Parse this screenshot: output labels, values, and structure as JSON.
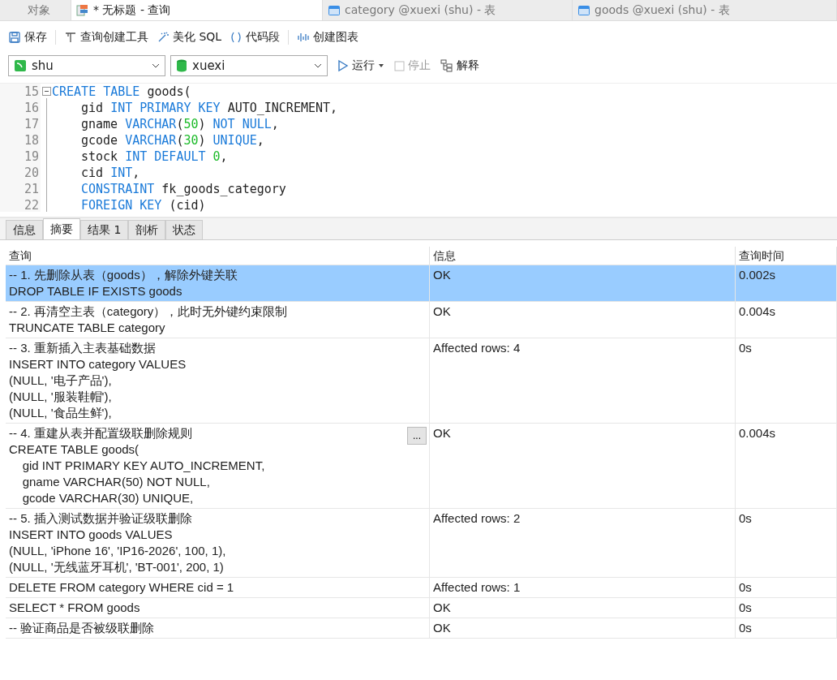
{
  "tabs": [
    {
      "label": "对象",
      "kind": "plain",
      "selected": false
    },
    {
      "label": "* 无标题 - 查询",
      "kind": "query",
      "selected": true
    },
    {
      "label": "category @xuexi (shu) - 表",
      "kind": "table",
      "selected": false
    },
    {
      "label": "goods @xuexi (shu) - 表",
      "kind": "table",
      "selected": false
    }
  ],
  "toolbar": [
    {
      "label": "保存",
      "kind": "save"
    },
    {
      "label": "查询创建工具",
      "kind": "builder"
    },
    {
      "label": "美化 SQL",
      "kind": "beautify"
    },
    {
      "label": "代码段",
      "kind": "snippet"
    },
    {
      "label": "创建图表",
      "kind": "chart"
    }
  ],
  "connection": {
    "value": "shu"
  },
  "database": {
    "value": "xuexi"
  },
  "actions": [
    {
      "label": "运行",
      "kind": "run",
      "disabled": false
    },
    {
      "label": "停止",
      "kind": "stop",
      "disabled": true
    },
    {
      "label": "解释",
      "kind": "explain",
      "disabled": false
    }
  ],
  "editor": {
    "lines": [
      {
        "number": "15",
        "fold": true,
        "indent": false,
        "tokens": [
          {
            "t": "CREATE TABLE ",
            "kind": "keyword"
          },
          {
            "t": "goods(",
            "kind": "plain"
          }
        ]
      },
      {
        "number": "16",
        "fold": false,
        "indent": true,
        "tokens": [
          {
            "t": "gid ",
            "kind": "plain"
          },
          {
            "t": "INT PRIMARY KEY ",
            "kind": "keyword"
          },
          {
            "t": "AUTO_INCREMENT,",
            "kind": "plain"
          }
        ]
      },
      {
        "number": "17",
        "fold": false,
        "indent": true,
        "tokens": [
          {
            "t": "gname ",
            "kind": "plain"
          },
          {
            "t": "VARCHAR",
            "kind": "keyword"
          },
          {
            "t": "(",
            "kind": "plain"
          },
          {
            "t": "50",
            "kind": "number"
          },
          {
            "t": ") ",
            "kind": "plain"
          },
          {
            "t": "NOT NULL",
            "kind": "keyword"
          },
          {
            "t": ",",
            "kind": "plain"
          }
        ]
      },
      {
        "number": "18",
        "fold": false,
        "indent": true,
        "tokens": [
          {
            "t": "gcode ",
            "kind": "plain"
          },
          {
            "t": "VARCHAR",
            "kind": "keyword"
          },
          {
            "t": "(",
            "kind": "plain"
          },
          {
            "t": "30",
            "kind": "number"
          },
          {
            "t": ") ",
            "kind": "plain"
          },
          {
            "t": "UNIQUE",
            "kind": "keyword"
          },
          {
            "t": ",",
            "kind": "plain"
          }
        ]
      },
      {
        "number": "19",
        "fold": false,
        "indent": true,
        "tokens": [
          {
            "t": "stock ",
            "kind": "plain"
          },
          {
            "t": "INT DEFAULT ",
            "kind": "keyword"
          },
          {
            "t": "0",
            "kind": "number"
          },
          {
            "t": ",",
            "kind": "plain"
          }
        ]
      },
      {
        "number": "20",
        "fold": false,
        "indent": true,
        "tokens": [
          {
            "t": "cid ",
            "kind": "plain"
          },
          {
            "t": "INT",
            "kind": "keyword"
          },
          {
            "t": ",",
            "kind": "plain"
          }
        ]
      },
      {
        "number": "21",
        "fold": false,
        "indent": true,
        "tokens": [
          {
            "t": "CONSTRAINT ",
            "kind": "keyword"
          },
          {
            "t": "fk_goods_category",
            "kind": "plain"
          }
        ]
      },
      {
        "number": "22",
        "fold": false,
        "indent": true,
        "tokens": [
          {
            "t": "FOREIGN KEY ",
            "kind": "keyword"
          },
          {
            "t": "(cid)",
            "kind": "plain"
          }
        ]
      }
    ]
  },
  "result_tabs": [
    {
      "label": "信息",
      "selected": false
    },
    {
      "label": "摘要",
      "selected": true
    },
    {
      "label": "结果 1",
      "selected": false
    },
    {
      "label": "剖析",
      "selected": false
    },
    {
      "label": "状态",
      "selected": false
    }
  ],
  "summary": {
    "columns": [
      "查询",
      "信息",
      "查询时间"
    ],
    "rows": [
      {
        "query": [
          "-- 1. 先删除从表（goods），解除外键关联",
          "DROP TABLE IF EXISTS goods"
        ],
        "info": "OK",
        "time": "0.002s",
        "selected": true
      },
      {
        "query": [
          "-- 2. 再清空主表（category），此时无外键约束限制",
          "TRUNCATE TABLE category"
        ],
        "info": "OK",
        "time": "0.004s",
        "selected": false
      },
      {
        "query": [
          "-- 3. 重新插入主表基础数据",
          "INSERT INTO category VALUES",
          "(NULL, '电子产品'),",
          "(NULL, '服装鞋帽'),",
          "(NULL, '食品生鲜'),"
        ],
        "info": "Affected rows: 4",
        "time": "0s",
        "selected": false
      },
      {
        "query": [
          "-- 4. 重建从表并配置级联删除规则",
          "CREATE TABLE goods(",
          "    gid INT PRIMARY KEY AUTO_INCREMENT,",
          "    gname VARCHAR(50) NOT NULL,",
          "    gcode VARCHAR(30) UNIQUE,"
        ],
        "more_button": "...",
        "info": "OK",
        "time": "0.004s",
        "selected": false
      },
      {
        "query": [
          "-- 5. 插入测试数据并验证级联删除",
          "INSERT INTO goods VALUES",
          "(NULL, 'iPhone 16', 'IP16-2026', 100, 1),",
          "(NULL, '无线蓝牙耳机', 'BT-001', 200, 1)"
        ],
        "info": "Affected rows: 2",
        "time": "0s",
        "selected": false
      },
      {
        "query": [
          "DELETE FROM category WHERE cid = 1"
        ],
        "info": "Affected rows: 1",
        "time": "0s",
        "selected": false
      },
      {
        "query": [
          "SELECT * FROM goods"
        ],
        "info": "OK",
        "time": "0s",
        "selected": false
      },
      {
        "query": [
          "-- 验证商品是否被级联删除"
        ],
        "info": "OK",
        "time": "0s",
        "selected": false
      }
    ]
  }
}
